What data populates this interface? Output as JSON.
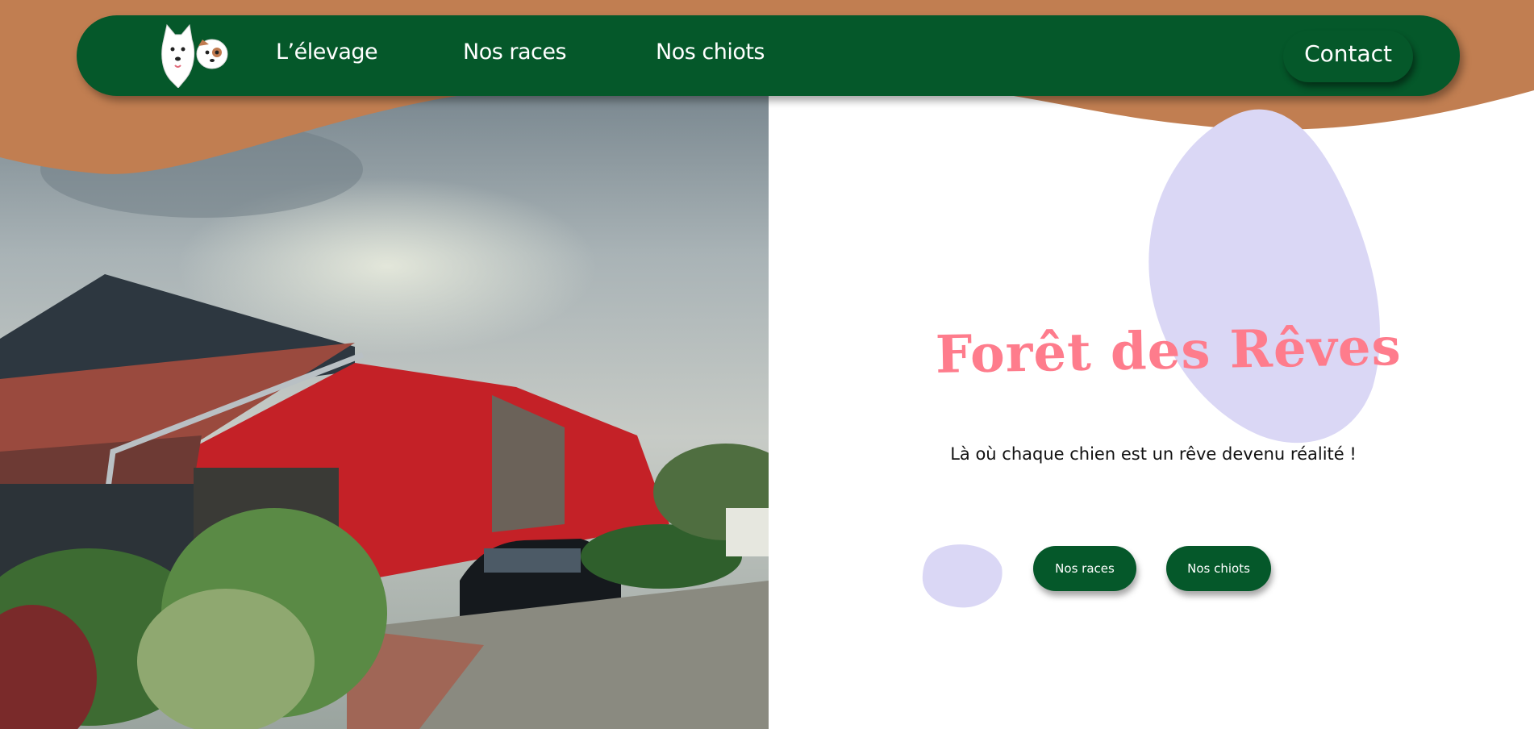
{
  "nav": {
    "logo_alt": "Forêt des Rêves",
    "links": [
      "L’élevage",
      "Nos races",
      "Nos chiots"
    ],
    "contact": "Contact"
  },
  "hero": {
    "title": "Forêt des Rêves",
    "tagline": "Là où chaque chien est un rêve devenu réalité !",
    "buttons": [
      "Nos races",
      "Nos chiots"
    ]
  },
  "colors": {
    "nav_green": "#05582a",
    "wave_orange": "#c17e51",
    "title_pink": "#fe7c8c",
    "blob_lavender": "#dad7f5"
  }
}
